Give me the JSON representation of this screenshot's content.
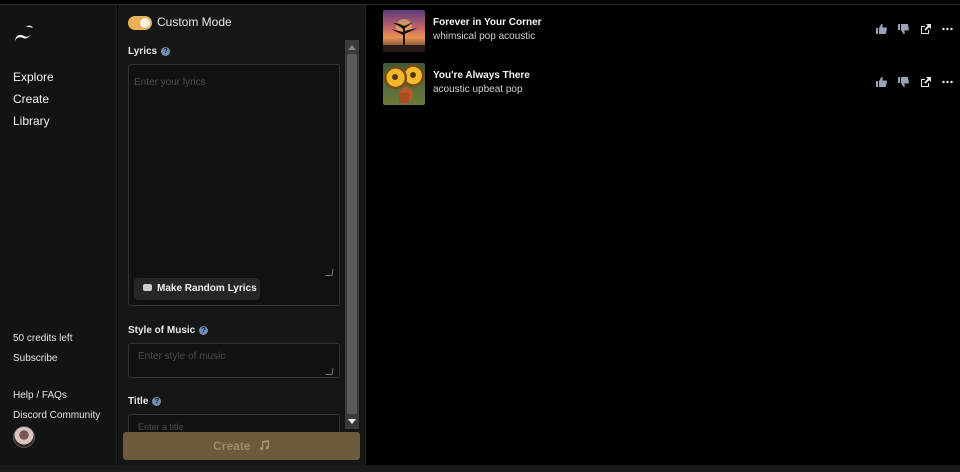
{
  "sidebar": {
    "nav": [
      {
        "label": "Explore"
      },
      {
        "label": "Create"
      },
      {
        "label": "Library"
      }
    ],
    "credits": "50 credits left",
    "subscribe": "Subscribe",
    "help": "Help / FAQs",
    "discord": "Discord Community"
  },
  "panel": {
    "mode_label": "Custom Mode",
    "custom_mode_on": true,
    "lyrics_label": "Lyrics",
    "lyrics_placeholder": "Enter your lyrics",
    "random_lyrics_button": "Make Random Lyrics",
    "style_label": "Style of Music",
    "style_placeholder": "Enter style of music",
    "title_label": "Title",
    "title_placeholder": "Enter a title",
    "create_button": "Create",
    "help_glyph": "?"
  },
  "songs": [
    {
      "title": "Forever in Your Corner",
      "tags": "whimsical pop acoustic"
    },
    {
      "title": "You're Always There",
      "tags": "acoustic upbeat pop"
    }
  ],
  "colors": {
    "accent": "#e9b25a",
    "create_button_bg": "#6b5a3b",
    "background": "#000000"
  }
}
